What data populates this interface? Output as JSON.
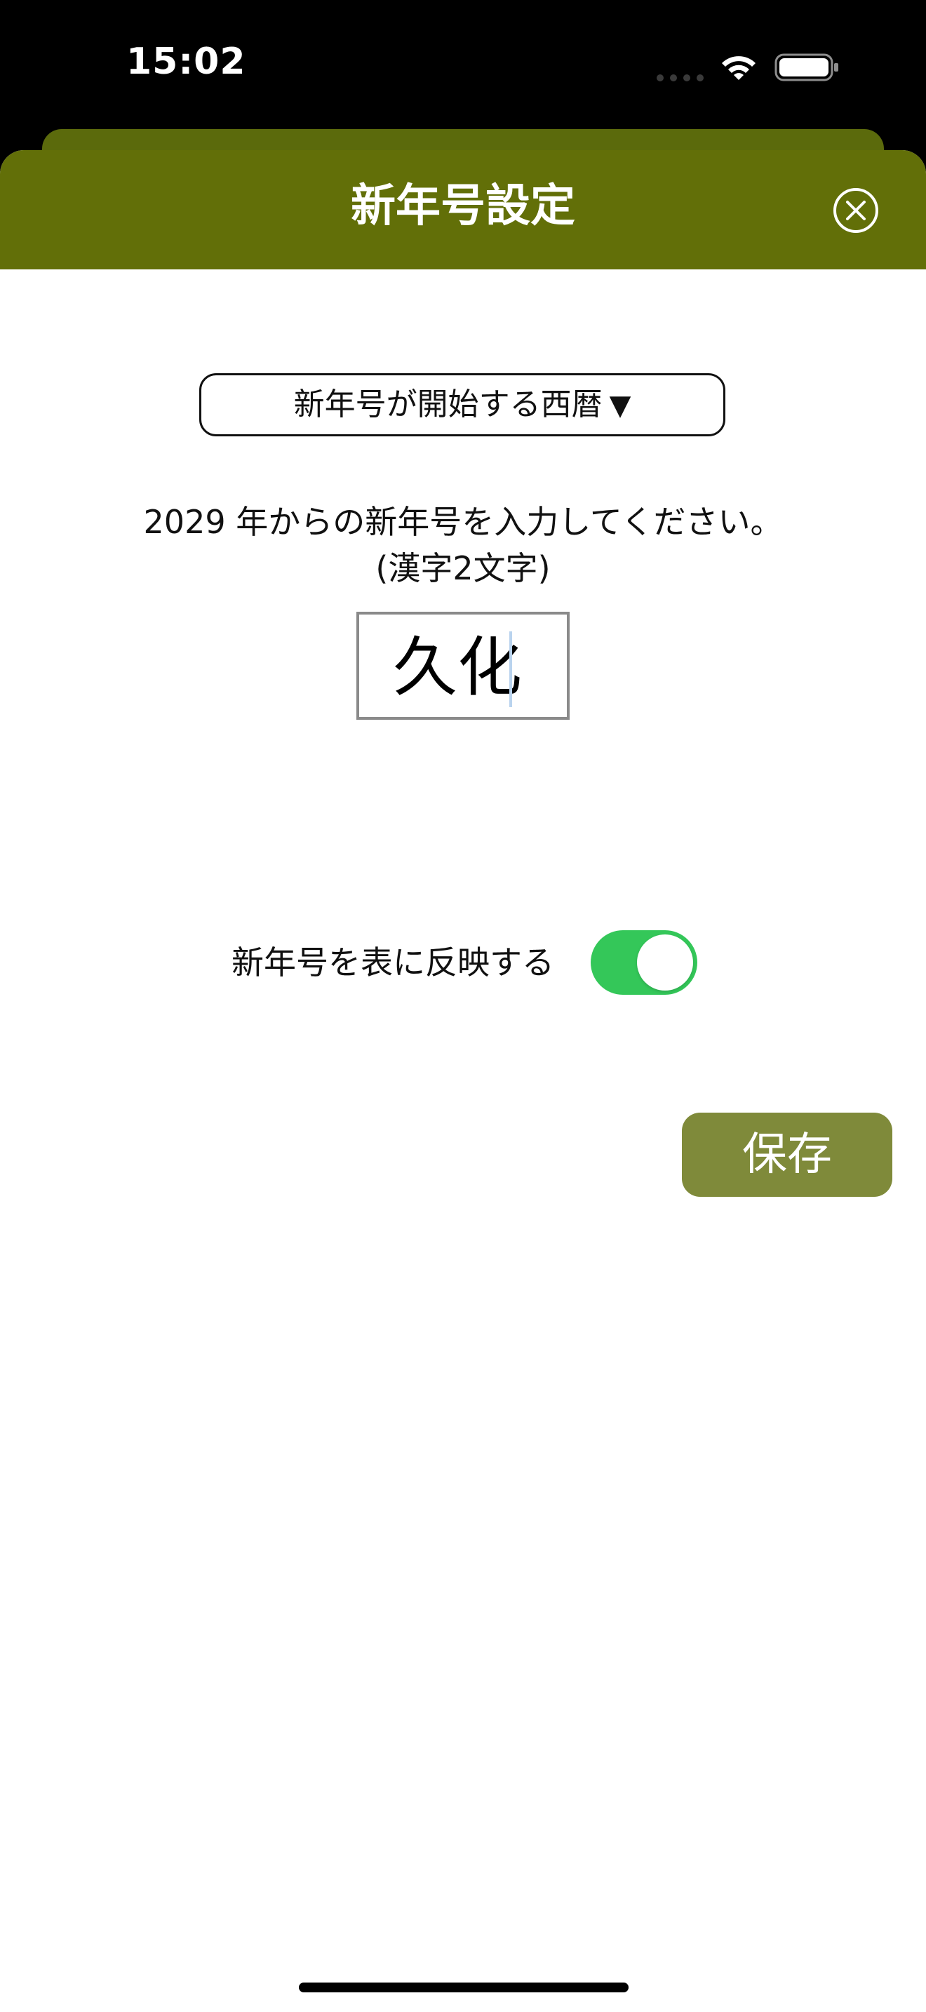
{
  "status_bar": {
    "time": "15:02",
    "icons": [
      "cellular-dots-icon",
      "wifi-icon",
      "battery-icon"
    ]
  },
  "header": {
    "title": "新年号設定",
    "close_icon": "close-circle-icon",
    "background_color": "#626f08"
  },
  "form": {
    "dropdown_label": "新年号が開始する西暦",
    "dropdown_arrow": "▼",
    "instruction": "2029 年からの新年号を入力してください。",
    "instruction_note": "(漢字2文字)",
    "era_name_value": "久化",
    "reflect_label": "新年号を表に反映する",
    "reflect_enabled": true,
    "toggle_on_color": "#34c759",
    "save_label": "保存",
    "save_color": "#7f8a3a"
  }
}
